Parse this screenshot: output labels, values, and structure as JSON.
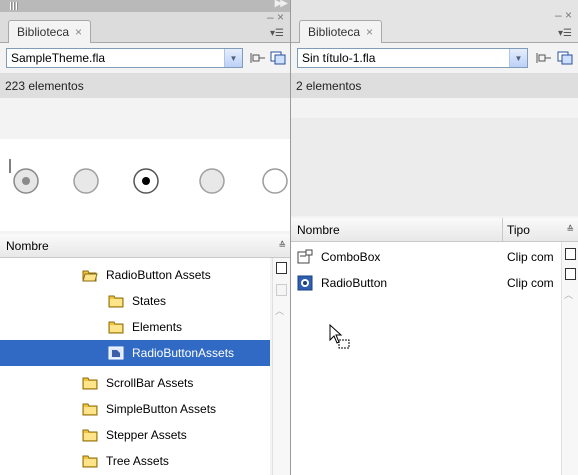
{
  "left_panel": {
    "tab_label": "Biblioteca",
    "close_glyph": "×",
    "minimize_glyph": "–",
    "close_panel_glyph": "×",
    "file_select": {
      "value": "SampleTheme.fla"
    },
    "item_count": "223 elementos",
    "column_name": "Nombre",
    "items": [
      {
        "label": "RadioButton Assets",
        "icon": "folder-open-icon",
        "indent": 1,
        "selected": false
      },
      {
        "label": "States",
        "icon": "folder-icon",
        "indent": 2,
        "selected": false
      },
      {
        "label": "Elements",
        "icon": "folder-icon",
        "indent": 2,
        "selected": false
      },
      {
        "label": "RadioButtonAssets",
        "icon": "movieclip-icon",
        "indent": 2,
        "selected": true
      },
      {
        "label": "ScrollBar Assets",
        "icon": "folder-icon",
        "indent": 1,
        "selected": false
      },
      {
        "label": "SimpleButton Assets",
        "icon": "folder-icon",
        "indent": 1,
        "selected": false
      },
      {
        "label": "Stepper Assets",
        "icon": "folder-icon",
        "indent": 1,
        "selected": false
      },
      {
        "label": "Tree Assets",
        "icon": "folder-icon",
        "indent": 1,
        "selected": false
      }
    ]
  },
  "right_panel": {
    "tab_label": "Biblioteca",
    "close_glyph": "×",
    "minimize_glyph": "–",
    "close_panel_glyph": "×",
    "file_select": {
      "value": "Sin título-1.fla"
    },
    "item_count": "2 elementos",
    "column_name": "Nombre",
    "column_type": "Tipo",
    "items": [
      {
        "label": "ComboBox",
        "type": "Clip com",
        "icon": "component-icon"
      },
      {
        "label": "RadioButton",
        "type": "Clip com",
        "icon": "radio-component-icon"
      }
    ]
  },
  "colors": {
    "selection": "#316ac5",
    "folder": "#f3c33a"
  }
}
